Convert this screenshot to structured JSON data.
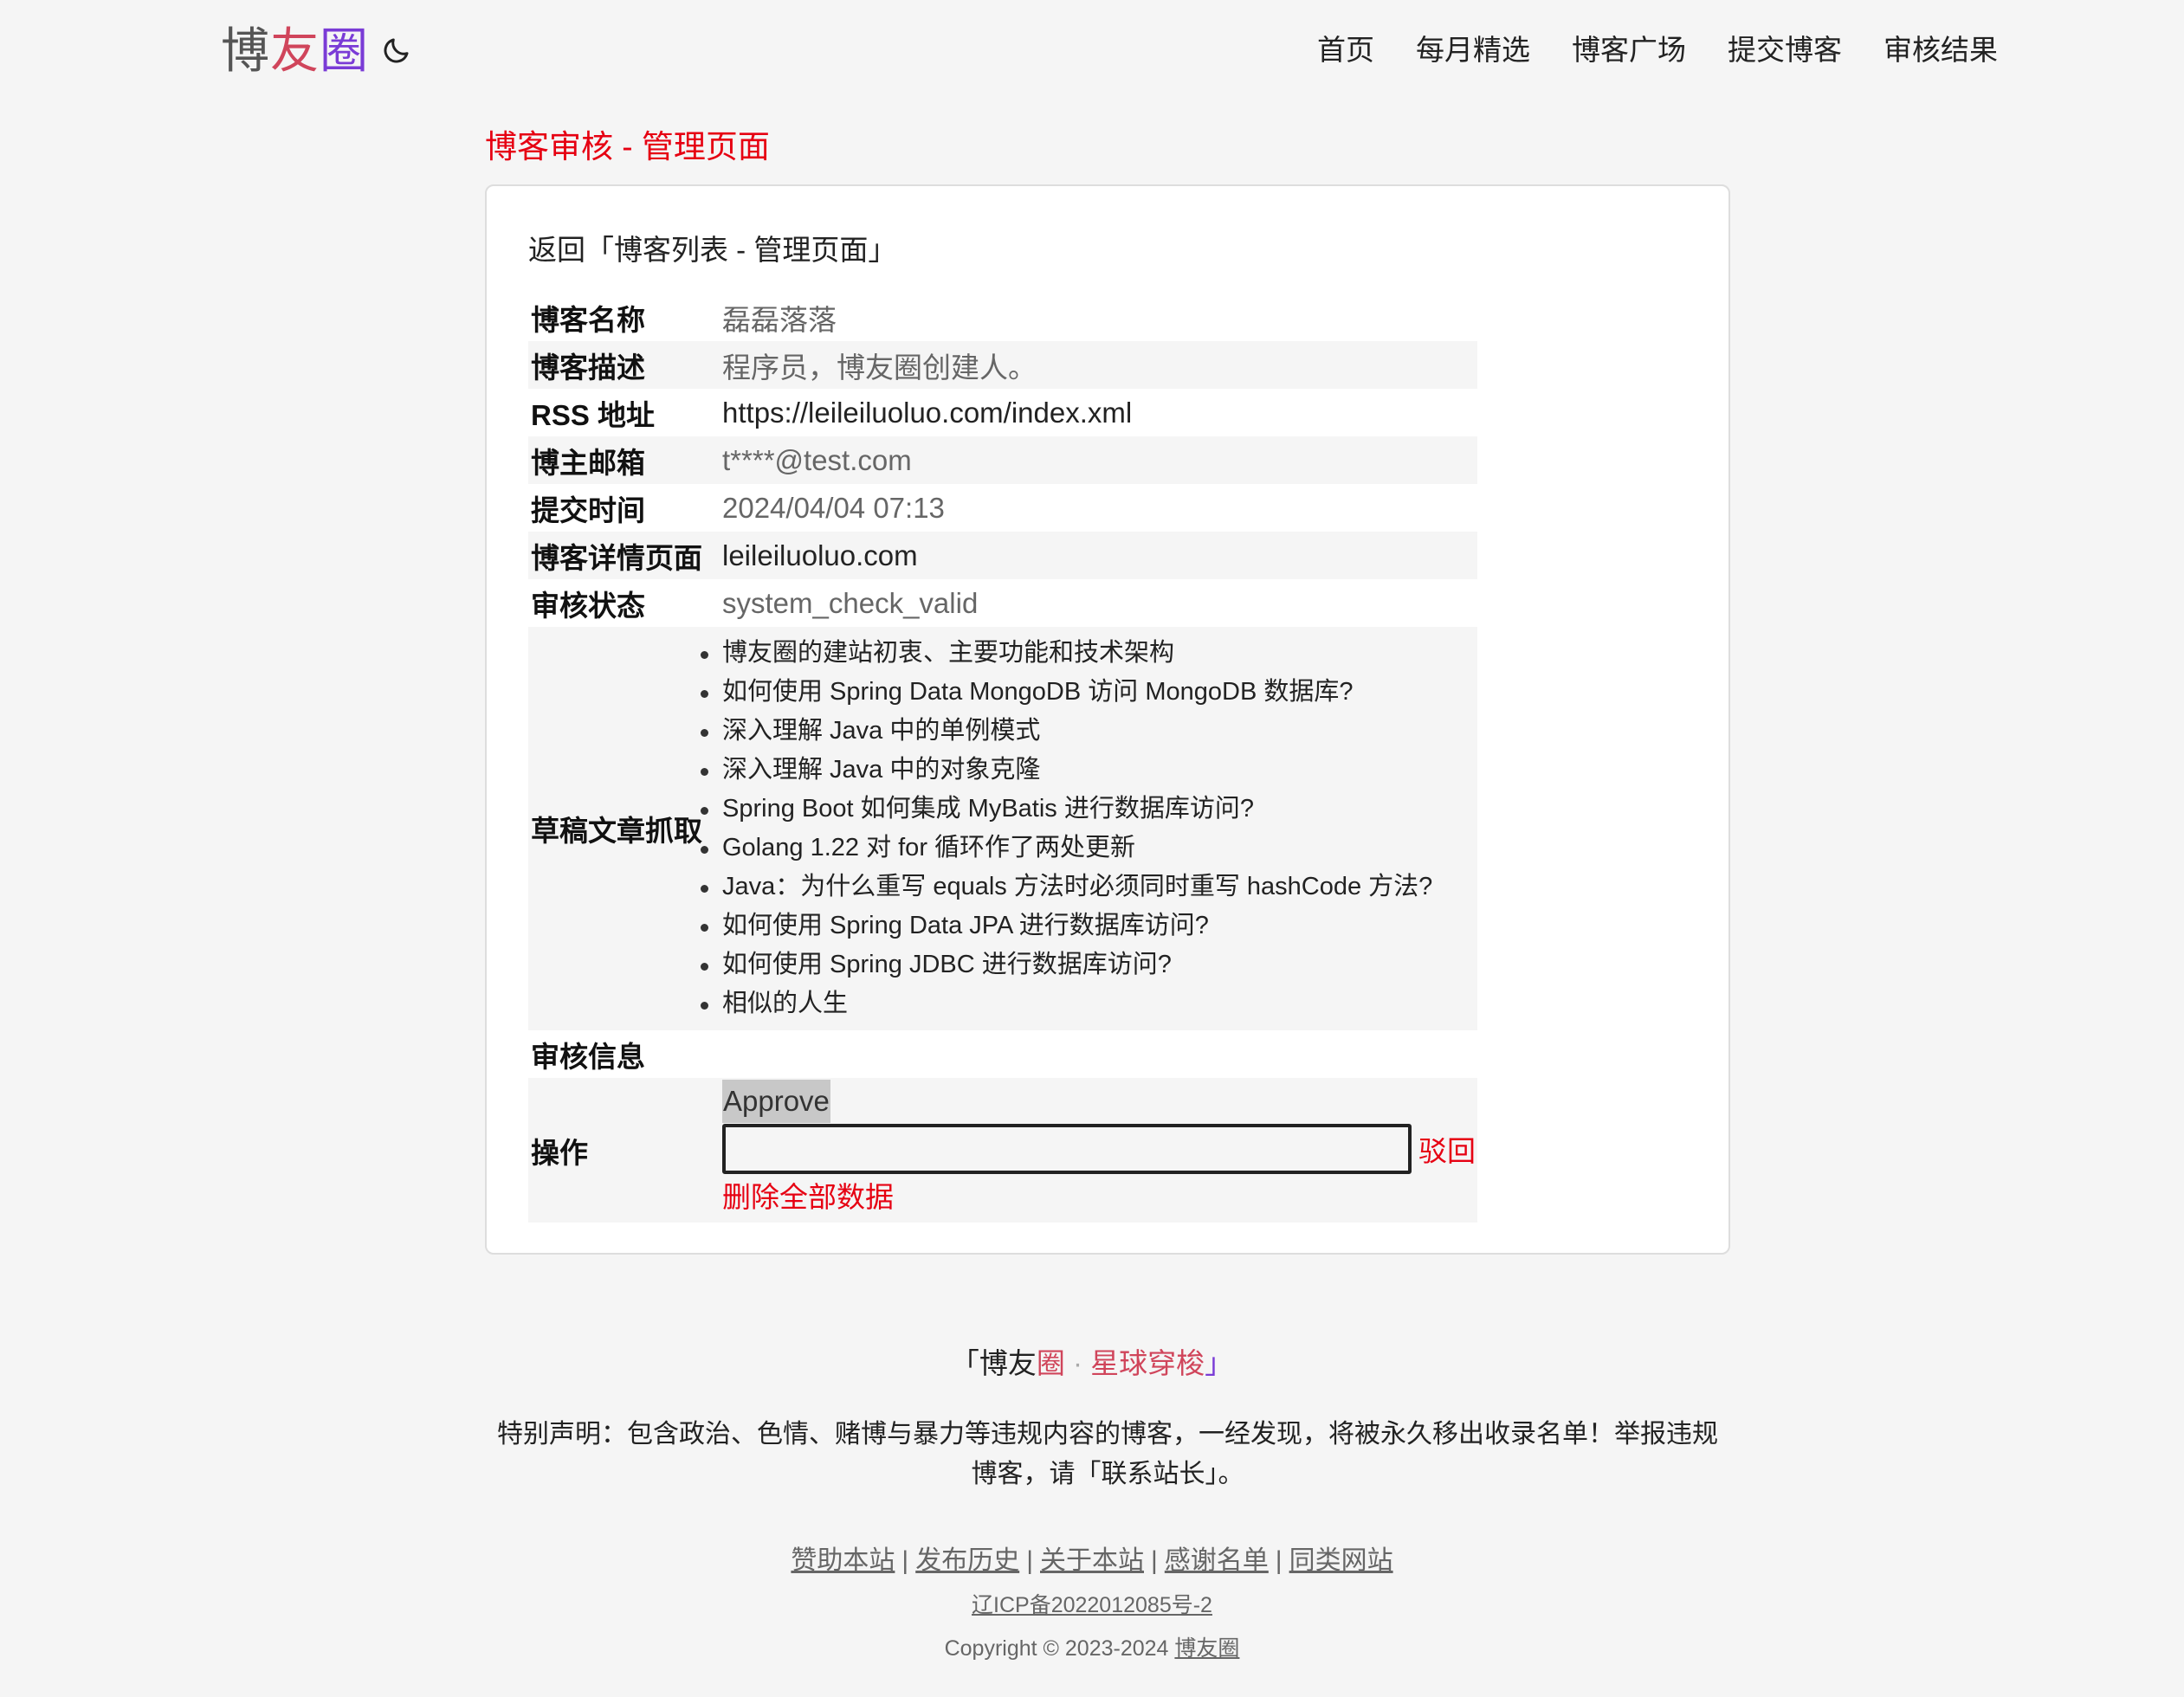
{
  "header": {
    "logo": [
      "博",
      "友",
      "圈"
    ],
    "theme_icon": "moon-icon",
    "nav": [
      "首页",
      "每月精选",
      "博客广场",
      "提交博客",
      "审核结果"
    ]
  },
  "page_title": "博客审核 - 管理页面",
  "back_link": "返回「博客列表 - 管理页面」",
  "fields": {
    "name": {
      "label": "博客名称",
      "value": "磊磊落落"
    },
    "desc": {
      "label": "博客描述",
      "value": "程序员，博友圈创建人。"
    },
    "rss": {
      "label": "RSS 地址",
      "value": "https://leileiluoluo.com/index.xml"
    },
    "email": {
      "label": "博主邮箱",
      "value": "t****@test.com"
    },
    "time": {
      "label": "提交时间",
      "value": "2024/04/04 07:13"
    },
    "detail": {
      "label": "博客详情页面",
      "value": "leileiluoluo.com"
    },
    "status": {
      "label": "审核状态",
      "value": "system_check_valid"
    },
    "drafts": {
      "label": "草稿文章抓取"
    },
    "review_info": {
      "label": "审核信息",
      "value": ""
    },
    "ops": {
      "label": "操作"
    }
  },
  "articles": [
    "博友圈的建站初衷、主要功能和技术架构",
    "如何使用 Spring Data MongoDB 访问 MongoDB 数据库?",
    "深入理解 Java 中的单例模式",
    "深入理解 Java 中的对象克隆",
    "Spring Boot 如何集成 MyBatis 进行数据库访问?",
    "Golang 1.22 对 for 循环作了两处更新",
    "Java：为什么重写 equals 方法时必须同时重写 hashCode 方法?",
    "如何使用 Spring Data JPA 进行数据库访问?",
    "如何使用 Spring JDBC 进行数据库访问?",
    "相似的人生"
  ],
  "actions": {
    "approve": "Approve",
    "reason_value": "",
    "reject": "驳回",
    "delete": "删除全部数据"
  },
  "footer": {
    "brand_open": "「",
    "brand_a": "博友",
    "brand_b": "圈",
    "brand_dot": "·",
    "brand_c": "星球穿梭",
    "brand_close": "」",
    "notice": "特别声明：包含政治、色情、赌博与暴力等违规内容的博客，一经发现，将被永久移出收录名单！举报违规博客，请",
    "contact": "「联系站长」",
    "notice_end": "。",
    "links": [
      "赞助本站",
      "发布历史",
      "关于本站",
      "感谢名单",
      "同类网站"
    ],
    "separator": "|",
    "icp": "辽ICP备2022012085号-2",
    "copyright": "Copyright © 2023-2024",
    "copyright_link": "博友圈"
  }
}
